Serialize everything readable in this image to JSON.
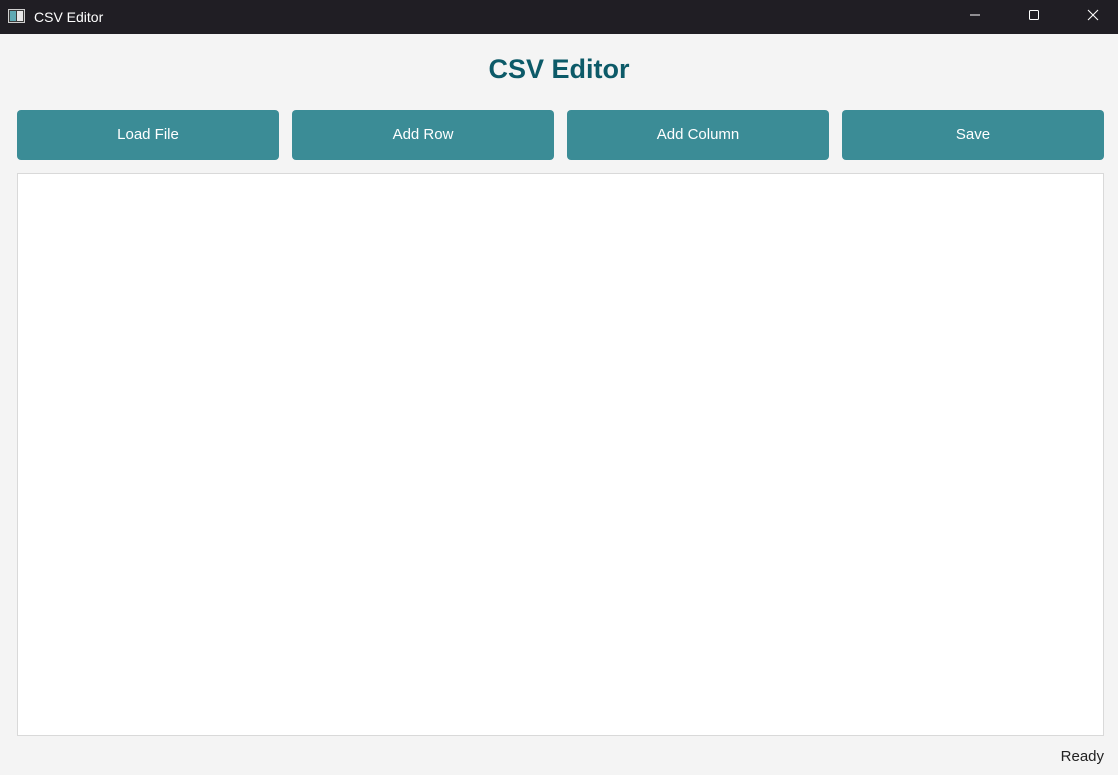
{
  "window": {
    "title": "CSV Editor",
    "icon": "app-window-icon",
    "controls": [
      "minimize-icon",
      "maximize-icon",
      "close-icon"
    ]
  },
  "heading": "CSV Editor",
  "toolbar": {
    "load_label": "Load File",
    "add_row_label": "Add Row",
    "add_column_label": "Add Column",
    "save_label": "Save"
  },
  "table": {
    "rows": [],
    "columns": []
  },
  "status": "Ready",
  "colors": {
    "titlebar": "#201e24",
    "heading": "#0c5a68",
    "button": "#3b8c96",
    "background": "#f4f4f4"
  }
}
